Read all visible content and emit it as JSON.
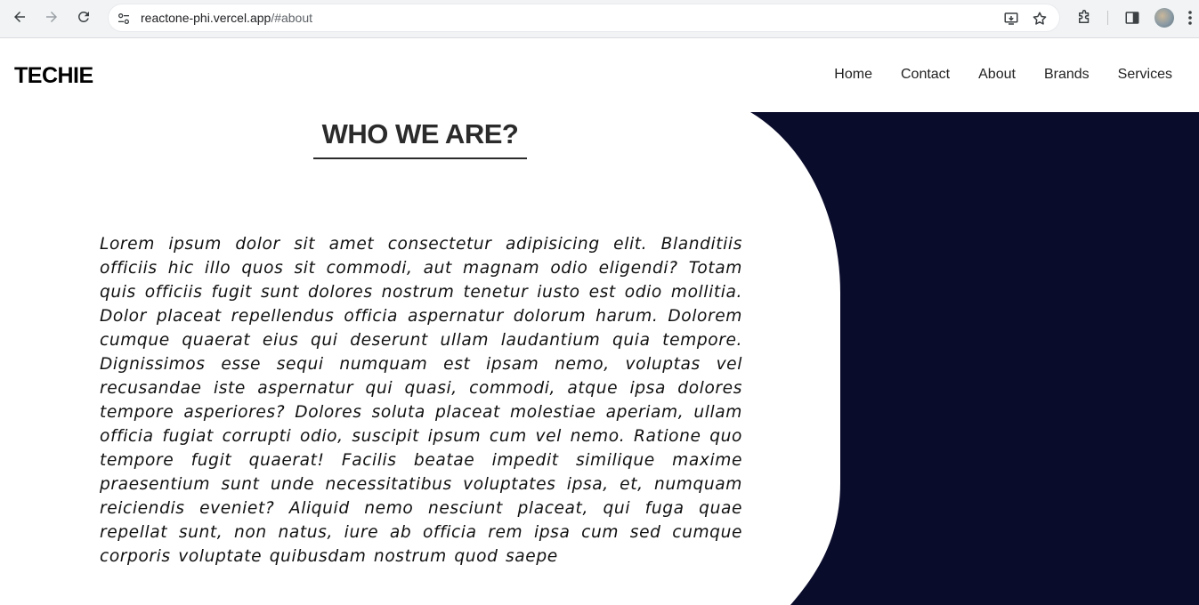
{
  "browser": {
    "url_host": "reactone-phi.vercel.app",
    "url_path": "/#about"
  },
  "site": {
    "brand": "TECHIE",
    "nav": [
      "Home",
      "Contact",
      "About",
      "Brands",
      "Services"
    ]
  },
  "about": {
    "heading": "WHO WE ARE?",
    "paragraph": "Lorem ipsum dolor sit amet consectetur adipisicing elit. Blanditiis officiis hic illo quos sit commodi, aut magnam odio eligendi? Totam quis officiis fugit sunt dolores nostrum tenetur iusto est odio mollitia. Dolor placeat repellendus officia aspernatur dolorum harum. Dolorem cumque quaerat eius qui deserunt ullam laudantium quia tempore. Dignissimos esse sequi numquam est ipsam nemo, voluptas vel recusandae iste aspernatur qui quasi, commodi, atque ipsa dolores tempore asperiores? Dolores soluta placeat molestiae aperiam, ullam officia fugiat corrupti odio, suscipit ipsum cum vel nemo. Ratione quo tempore fugit quaerat! Facilis beatae impedit similique maxime praesentium sunt unde necessitatibus voluptates ipsa, et, numquam reiciendis eveniet? Aliquid nemo nesciunt placeat, qui fuga quae repellat sunt, non natus, iure ab officia rem ipsa cum sed cumque corporis voluptate quibusdam nostrum quod saepe"
  },
  "colors": {
    "dark_panel": "#0a0c2c",
    "text": "#111111"
  },
  "icons": [
    "back-arrow-icon",
    "forward-arrow-icon",
    "reload-icon",
    "site-settings-icon",
    "install-app-icon",
    "bookmark-star-icon",
    "extensions-icon",
    "side-panel-icon",
    "profile-avatar",
    "more-menu-icon"
  ]
}
